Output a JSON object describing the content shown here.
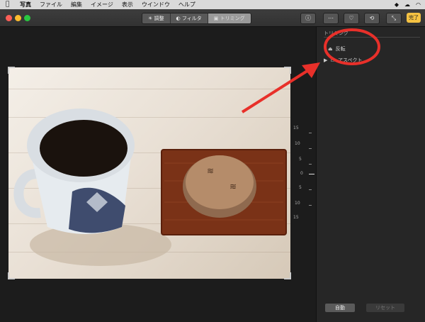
{
  "menubar": {
    "apple": "",
    "menus": [
      "写真",
      "ファイル",
      "編集",
      "イメージ",
      "表示",
      "ウインドウ",
      "ヘルプ"
    ]
  },
  "toolbar": {
    "tabs": [
      "調整",
      "フィルタ",
      "トリミング"
    ],
    "done_label": "完了"
  },
  "dial": {
    "labels": [
      "15",
      "10",
      "5",
      "0",
      "5",
      "10",
      "15"
    ]
  },
  "panel": {
    "title": "トリミング",
    "flip_label": "反転",
    "aspect_label": "アスペクト",
    "reset_label": "自動",
    "revert_label": "リセット"
  },
  "colors": {
    "accent": "#f5c242",
    "annotation": "#e8302a"
  }
}
